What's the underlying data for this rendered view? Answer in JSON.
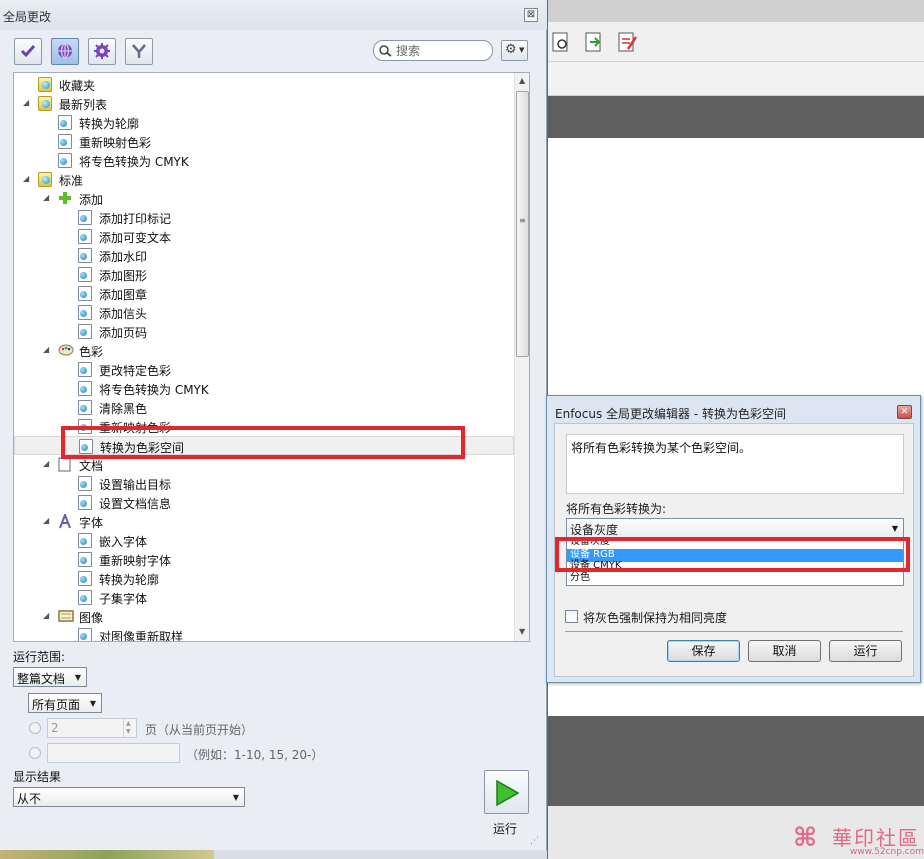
{
  "panel": {
    "title": "全局更改",
    "close_glyph": "⊠",
    "toolbar_icons": [
      "checkmark-icon",
      "globe-icon",
      "gear-icon",
      "funnel-icon"
    ],
    "search_placeholder": "搜索",
    "settings_icon": "gear-dropdown-icon"
  },
  "tree": {
    "items": [
      {
        "label": "收藏夹",
        "level": 1,
        "kind": "group",
        "expander": ""
      },
      {
        "label": "最新列表",
        "level": 1,
        "kind": "group",
        "expander": "◢"
      },
      {
        "label": "转换为轮廓",
        "level": 2,
        "kind": "doc",
        "expander": ""
      },
      {
        "label": "重新映射色彩",
        "level": 2,
        "kind": "doc",
        "expander": ""
      },
      {
        "label": "将专色转换为 CMYK",
        "level": 2,
        "kind": "doc",
        "expander": ""
      },
      {
        "label": "标准",
        "level": 1,
        "kind": "group",
        "expander": "◢"
      },
      {
        "label": "添加",
        "level": 2,
        "kind": "plus",
        "expander": "◢"
      },
      {
        "label": "添加打印标记",
        "level": 3,
        "kind": "doc",
        "expander": ""
      },
      {
        "label": "添加可变文本",
        "level": 3,
        "kind": "doc",
        "expander": ""
      },
      {
        "label": "添加水印",
        "level": 3,
        "kind": "doc",
        "expander": ""
      },
      {
        "label": "添加图形",
        "level": 3,
        "kind": "doc",
        "expander": ""
      },
      {
        "label": "添加图章",
        "level": 3,
        "kind": "doc",
        "expander": ""
      },
      {
        "label": "添加信头",
        "level": 3,
        "kind": "doc",
        "expander": ""
      },
      {
        "label": "添加页码",
        "level": 3,
        "kind": "doc",
        "expander": ""
      },
      {
        "label": "色彩",
        "level": 2,
        "kind": "palette",
        "expander": "◢"
      },
      {
        "label": "更改特定色彩",
        "level": 3,
        "kind": "doc",
        "expander": ""
      },
      {
        "label": "将专色转换为 CMYK",
        "level": 3,
        "kind": "doc",
        "expander": ""
      },
      {
        "label": "清除黑色",
        "level": 3,
        "kind": "doc",
        "expander": ""
      },
      {
        "label": "重新映射色彩",
        "level": 3,
        "kind": "doc",
        "expander": ""
      },
      {
        "label": "转换为色彩空间",
        "level": 3,
        "kind": "doc",
        "expander": "",
        "selected": true
      },
      {
        "label": "文档",
        "level": 2,
        "kind": "page",
        "expander": "◢"
      },
      {
        "label": "设置输出目标",
        "level": 3,
        "kind": "doc",
        "expander": ""
      },
      {
        "label": "设置文档信息",
        "level": 3,
        "kind": "doc",
        "expander": ""
      },
      {
        "label": "字体",
        "level": 2,
        "kind": "font",
        "expander": "◢"
      },
      {
        "label": "嵌入字体",
        "level": 3,
        "kind": "doc",
        "expander": ""
      },
      {
        "label": "重新映射字体",
        "level": 3,
        "kind": "doc",
        "expander": ""
      },
      {
        "label": "转换为轮廓",
        "level": 3,
        "kind": "doc",
        "expander": ""
      },
      {
        "label": "子集字体",
        "level": 3,
        "kind": "doc",
        "expander": ""
      },
      {
        "label": "图像",
        "level": 2,
        "kind": "image",
        "expander": "◢"
      },
      {
        "label": "对图像重新取样",
        "level": 3,
        "kind": "doc",
        "expander": ""
      }
    ]
  },
  "scope": {
    "label": "运行范围:",
    "scope_value": "整篇文档",
    "pages_value": "所有页面",
    "page_count_value": "2",
    "page_suffix": "页（从当前页开始）",
    "range_hint": "（例如：1-10, 15, 20-）"
  },
  "results": {
    "label": "显示结果",
    "value": "从不"
  },
  "run": {
    "label": "运行"
  },
  "dialog": {
    "title": "Enfocus 全局更改编辑器 - 转换为色彩空间",
    "close_glyph": "✕",
    "description": "将所有色彩转换为某个色彩空间。",
    "convert_label": "将所有色彩转换为:",
    "selected_value": "设备灰度",
    "options": [
      "设备灰度",
      "设备 RGB",
      "设备 CMYK",
      "分色"
    ],
    "highlighted_option": "设备 RGB",
    "gray_checkbox_label": "将灰色强制保持为相同亮度",
    "gray_checked": false,
    "save_label": "保存",
    "cancel_label": "取消",
    "run_label": "运行"
  },
  "watermark": {
    "text": "華印社區",
    "url": "www.52cnp.com"
  },
  "colors": {
    "highlight_red": "#e4262d",
    "selection_blue": "#3399ff",
    "run_green": "#3fbf2f"
  }
}
